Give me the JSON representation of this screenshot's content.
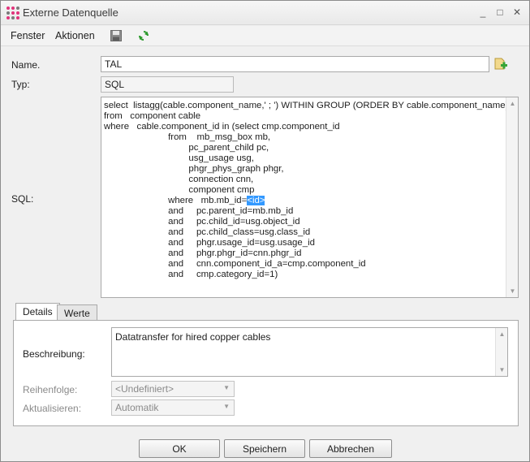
{
  "window": {
    "title": "Externe Datenquelle",
    "controls": [
      "_",
      "□",
      "✕"
    ]
  },
  "menu": {
    "items": [
      "Fenster",
      "Aktionen"
    ],
    "icons": [
      "save-icon",
      "refresh-icon"
    ]
  },
  "form": {
    "name_label": "Name.",
    "name_value": "TAL",
    "type_label": "Typ:",
    "type_value": "SQL",
    "sql_label": "SQL:",
    "sql_before": "select  listagg(cable.component_name,' ; ') WITHIN GROUP (ORDER BY cable.component_name)\nfrom   component cable\nwhere   cable.component_id in (select cmp.component_id\n                         from    mb_msg_box mb,\n                                 pc_parent_child pc,\n                                 usg_usage usg,\n                                 phgr_phys_graph phgr,\n                                 connection cnn,\n                                 component cmp\n                         where   mb.mb_id=",
    "sql_selected": "<id>",
    "sql_after": "\n                         and     pc.parent_id=mb.mb_id\n                         and     pc.child_id=usg.object_id\n                         and     pc.child_class=usg.class_id\n                         and     phgr.usage_id=usg.usage_id\n                         and     phgr.phgr_id=cnn.phgr_id\n                         and     cnn.component_id_a=cmp.component_id\n                         and     cmp.category_id=1)"
  },
  "tabs": [
    {
      "label": "Details",
      "active": true
    },
    {
      "label": "Werte",
      "active": false
    }
  ],
  "details": {
    "description_label": "Beschreibung:",
    "description_value": "Datatransfer for hired copper cables",
    "order_label": "Reihenfolge:",
    "order_value": "<Undefiniert>",
    "refresh_label": "Aktualisieren:",
    "refresh_value": "Automatik"
  },
  "buttons": {
    "ok": "OK",
    "save": "Speichern",
    "cancel": "Abbrechen"
  },
  "colors": {
    "selection": "#3399ff",
    "refresh_icon": "#2e9a2e"
  }
}
